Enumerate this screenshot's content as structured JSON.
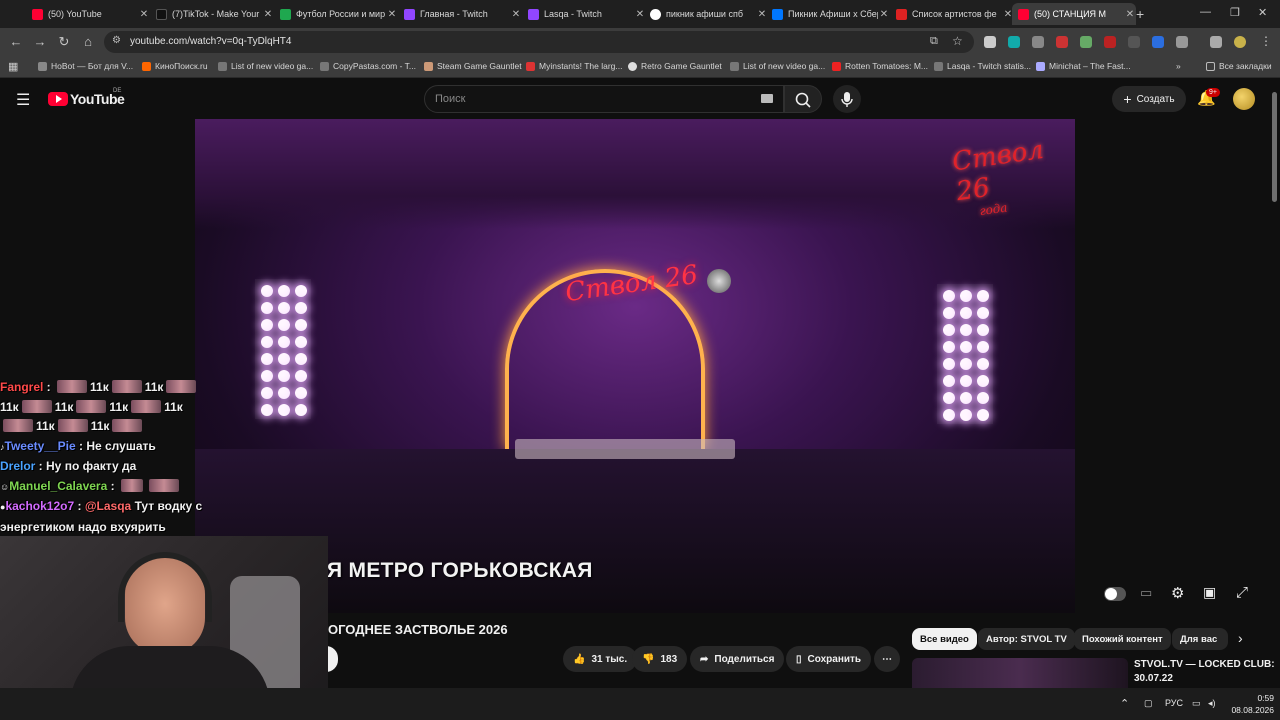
{
  "browser": {
    "tabs": [
      {
        "title": "(50) YouTube",
        "color": "#ff0033"
      },
      {
        "title": "(7)TikTok - Make Your",
        "color": "#1a1a1a"
      },
      {
        "title": "Футбол России и мир",
        "color": "#1fa84f"
      },
      {
        "title": "Главная - Twitch",
        "color": "#9146ff"
      },
      {
        "title": "Lasqa - Twitch",
        "color": "#9146ff"
      },
      {
        "title": "пикник афиши спб",
        "color": "#4285f4"
      },
      {
        "title": "Пикник Афиши x Сбер",
        "color": "#0077ff"
      },
      {
        "title": "Список артистов фе",
        "color": "#d22"
      },
      {
        "title": "(50) СТАНЦИЯ М",
        "color": "#ff0033"
      }
    ],
    "url": "youtube.com/watch?v=0q-TyDlqHT4",
    "bookmarks": [
      "HoBot — Бот для V...",
      "КиноПоиск.ru",
      "List of new video ga...",
      "CopyPastas.com - T...",
      "Steam Game Gauntlet",
      "Myinstants! The larg...",
      "Retro Game Gauntlet",
      "List of new video ga...",
      "Rotten Tomatoes: M...",
      "Lasqa - Twitch statis...",
      "Minichat – The Fast..."
    ],
    "all_bookmarks": "Все закладки",
    "new_tab_icon": "plus-icon"
  },
  "youtube": {
    "logo_text": "YouTube",
    "region": "DE",
    "search_placeholder": "Поиск",
    "create_label": "Создать",
    "notifications_badge": "9+",
    "video": {
      "caption": "Я МЕТРО ГОРЬКОВСКАЯ",
      "logo_overlay": "Ствол 26",
      "logo_sub": "года",
      "title": "ОГОДНЕЕ ЗАСТВОЛЬЕ 2026",
      "likes": "31 тыс.",
      "dislikes": "183",
      "share_label": "Поделиться",
      "save_label": "Сохранить"
    },
    "chips": [
      "Все видео",
      "Автор: STVOL TV",
      "Похожий контент",
      "Для вас"
    ],
    "recommended": {
      "title_line1": "STVOL.TV — LOCKED CLUB:",
      "title_line2": "30.07.22"
    }
  },
  "chat": [
    {
      "user": "Fangrel",
      "color": "#ff4a4a",
      "text": "11к"
    },
    {
      "user": "Tweety__Pie",
      "color": "#6a8cff",
      "text": "Не слушать"
    },
    {
      "user": "Drelor",
      "color": "#4aa3ff",
      "text": "Ну по факту да"
    },
    {
      "user": "Manuel_Calavera",
      "color": "#7fd651",
      "text": ""
    },
    {
      "user": "kachok12o7",
      "color": "#d36bff",
      "mention": "@Lasqa",
      "text": "Тут водку с энергетиком надо вхуярить"
    }
  ],
  "taskbar": {
    "lang": "РУС",
    "time": "0:59",
    "date": "08.08.2026"
  }
}
